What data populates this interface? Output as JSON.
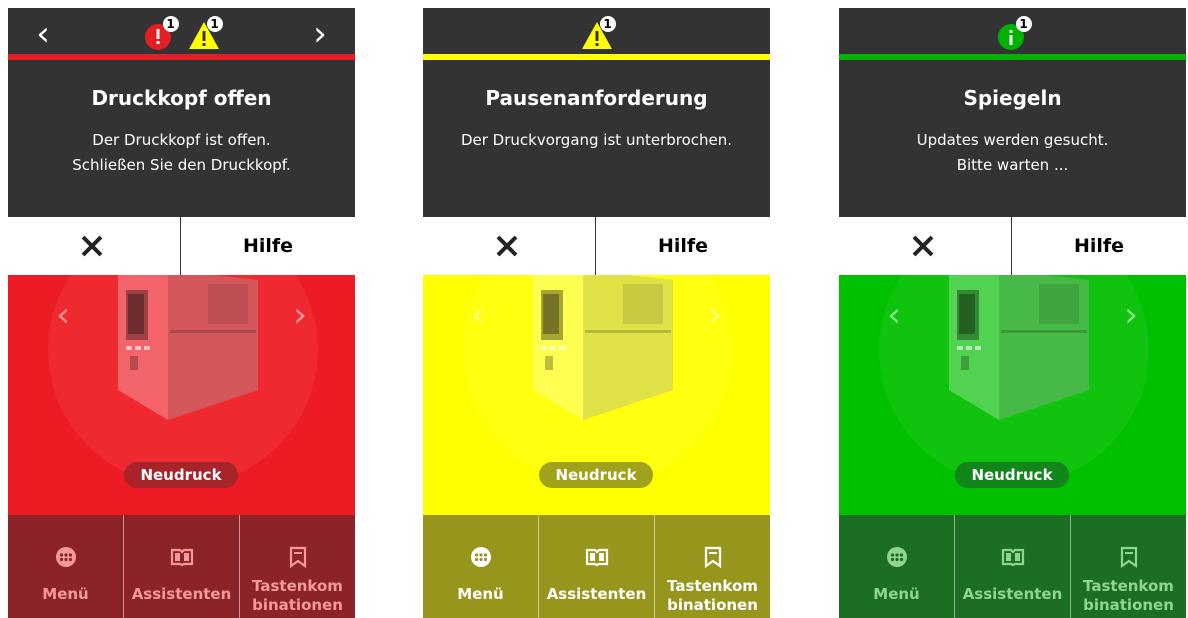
{
  "screens": [
    {
      "theme": "red",
      "colors": {
        "accent": "#e31e24",
        "area": "#ed1c24",
        "bottom": "#8b2328",
        "pill": "#a8242b",
        "tabtext": "#f79a9d"
      },
      "has_nav_arrows": true,
      "status_icons": [
        {
          "type": "error-icon",
          "count": "1",
          "color": "#e31e24"
        },
        {
          "type": "warning-icon",
          "count": "1",
          "color": "#ffff00"
        }
      ],
      "title": "Druckkopf offen",
      "line1": "Der Druckkopf ist offen.",
      "line2": "Schließen Sie den Druckkopf.",
      "close_glyph": "✕",
      "help": "Hilfe",
      "reprint": "Neudruck",
      "tabs": [
        "Menü",
        "Assistenten",
        "Tastenkom",
        "binationen"
      ]
    },
    {
      "theme": "yellow",
      "colors": {
        "accent": "#ffff00",
        "area": "#ffff00",
        "bottom": "#96961d",
        "pill": "#a0a21a",
        "tabtext": "#ffffff"
      },
      "has_nav_arrows": false,
      "status_icons": [
        {
          "type": "warning-icon",
          "count": "1",
          "color": "#ffff00"
        }
      ],
      "title": "Pausenanforderung",
      "line1": "Der Druckvorgang ist unterbrochen.",
      "line2": "",
      "close_glyph": "✕",
      "help": "Hilfe",
      "reprint": "Neudruck",
      "tabs": [
        "Menü",
        "Assistenten",
        "Tastenkom",
        "binationen"
      ]
    },
    {
      "theme": "green",
      "colors": {
        "accent": "#00b300",
        "area": "#00c000",
        "bottom": "#1c6e22",
        "pill": "#12851b",
        "tabtext": "#8fd48f"
      },
      "has_nav_arrows": false,
      "status_icons": [
        {
          "type": "info-icon",
          "count": "1",
          "color": "#00b300"
        }
      ],
      "title": "Spiegeln",
      "line1": "Updates werden gesucht.",
      "line2": "Bitte warten ...",
      "close_glyph": "✕",
      "help": "Hilfe",
      "reprint": "Neudruck",
      "tabs": [
        "Menü",
        "Assistenten",
        "Tastenkom",
        "binationen"
      ]
    }
  ],
  "glyphs": {
    "nav_left": "‹",
    "nav_right": "›",
    "carousel_left": "‹",
    "carousel_right": "›"
  }
}
